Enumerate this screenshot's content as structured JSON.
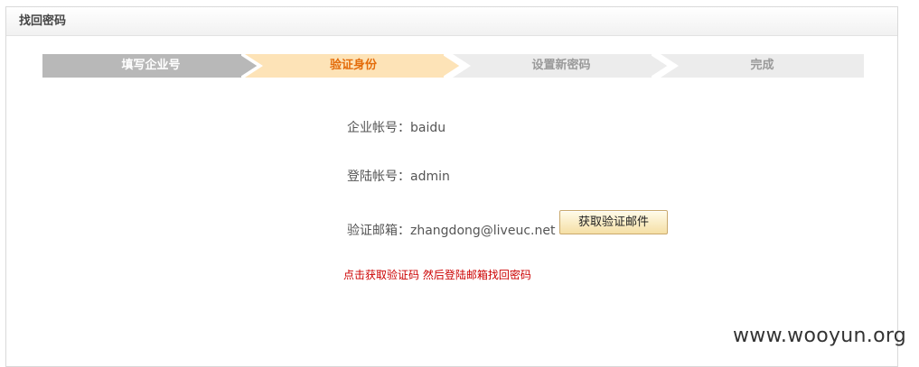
{
  "panel": {
    "title": "找回密码"
  },
  "steps": [
    {
      "label": "填写企业号",
      "state": "done",
      "color": "#b8b8b8"
    },
    {
      "label": "验证身份",
      "state": "active",
      "color": "#fde3b7"
    },
    {
      "label": "设置新密码",
      "state": "pending",
      "color": "#ececec"
    },
    {
      "label": "完成",
      "state": "pending",
      "color": "#ececec"
    }
  ],
  "form": {
    "company_label": "企业帐号：",
    "company_value": "baidu",
    "login_label": "登陆帐号：",
    "login_value": "admin",
    "email_label": "验证邮箱：",
    "email_value": "zhangdong@liveuc.net",
    "get_code_button": "获取验证邮件",
    "hint": "点击获取验证码 然后登陆邮箱找回密码"
  },
  "watermark": "www.wooyun.org",
  "colors": {
    "active_step_text": "#e46c0a",
    "hint_text": "#cc0000"
  }
}
